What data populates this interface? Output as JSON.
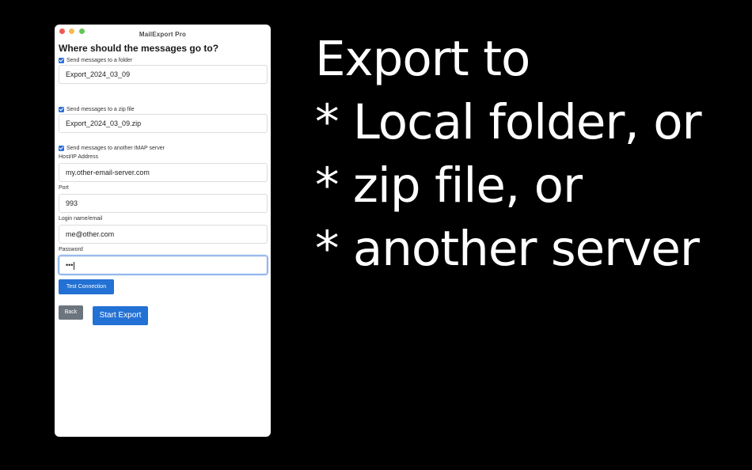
{
  "window": {
    "title": "MailExport Pro"
  },
  "form": {
    "heading": "Where should the messages go to?",
    "folder": {
      "checkbox_label": "Send messages to a folder",
      "checked": true,
      "value": "Export_2024_03_09"
    },
    "zip": {
      "checkbox_label": "Send messages to a zip file",
      "checked": true,
      "value": "Export_2024_03_09.zip"
    },
    "imap": {
      "checkbox_label": "Send messages to another IMAP server",
      "checked": true,
      "host_label": "Host/IP Address",
      "host_value": "my.other-email-server.com",
      "port_label": "Port",
      "port_value": "993",
      "login_label": "Login name/email",
      "login_value": "me@other.com",
      "password_label": "Password",
      "password_value": "•••"
    },
    "test_connection_label": "Test Connection",
    "back_label": "Back",
    "start_export_label": "Start Export"
  },
  "slogan": {
    "lines": [
      "Export to",
      "* Local folder, or",
      "* zip file, or",
      "* another server"
    ]
  },
  "colors": {
    "background": "#000000",
    "accent": "#2371d4",
    "secondary_button": "#6c757d",
    "window_bg": "#ffffff",
    "close": "#ee5a52",
    "minimize": "#f5bd4f",
    "zoom": "#61c454"
  }
}
